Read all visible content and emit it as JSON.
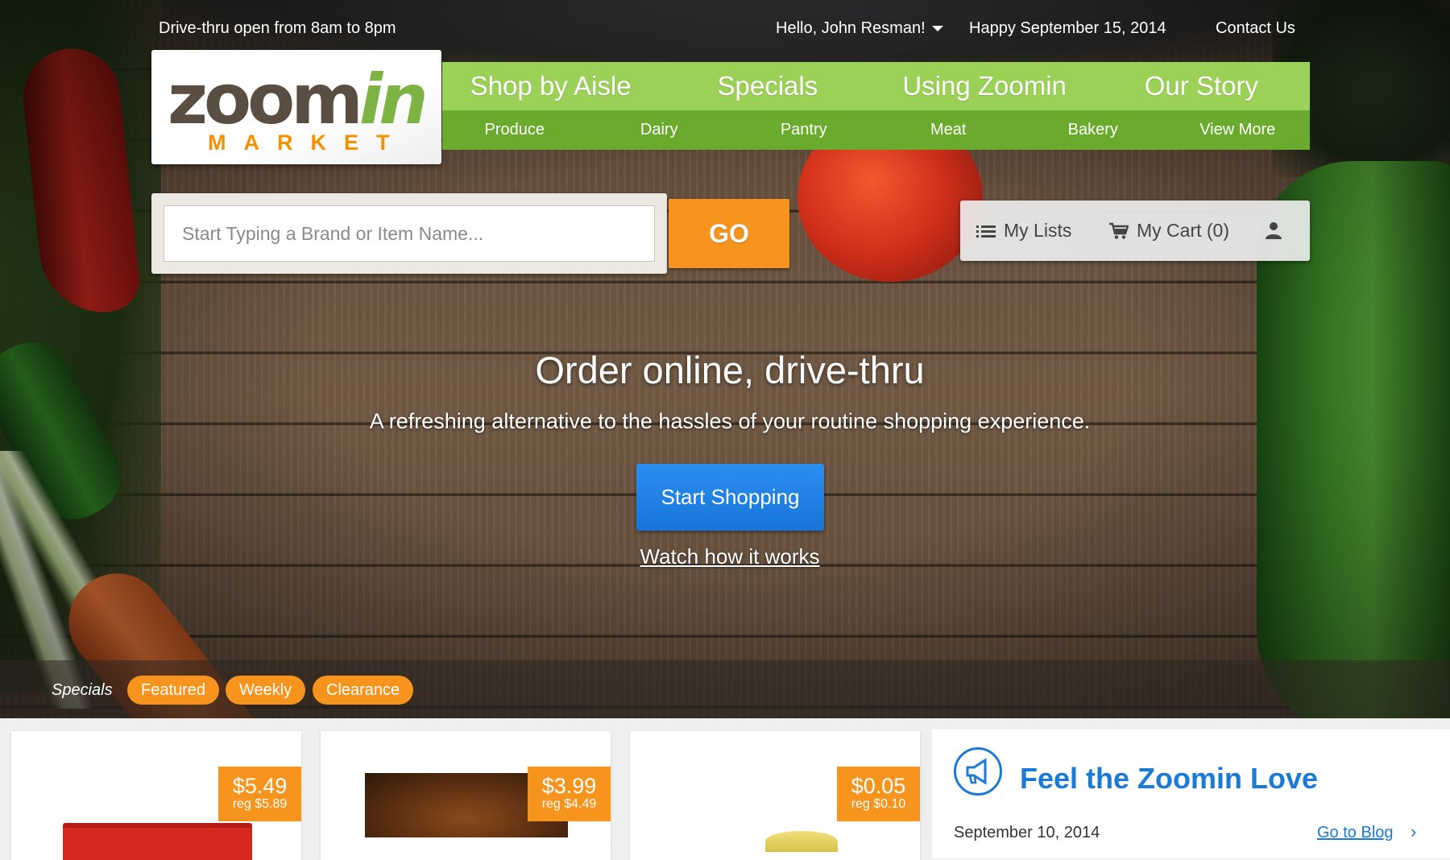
{
  "topbar": {
    "hours": "Drive-thru open from 8am to 8pm",
    "greeting": "Hello, John Resman!",
    "date": "Happy September 15, 2014",
    "contact": "Contact Us"
  },
  "logo": {
    "word_zoom": "zoom",
    "word_in": "in",
    "market": "MARKET"
  },
  "nav": {
    "main": [
      "Shop by Aisle",
      "Specials",
      "Using Zoomin",
      "Our Story"
    ],
    "sub": [
      "Produce",
      "Dairy",
      "Pantry",
      "Meat",
      "Bakery",
      "View More"
    ]
  },
  "search": {
    "placeholder": "Start Typing a Brand or Item Name...",
    "value": "",
    "button": "GO"
  },
  "account": {
    "lists": "My Lists",
    "cart": "My Cart (0)",
    "icons": [
      "list-icon",
      "cart-icon",
      "user-icon"
    ]
  },
  "hero": {
    "title": "Order online, drive-thru",
    "subtitle": "A refreshing alternative to the hassles of your routine shopping experience.",
    "cta": "Start Shopping",
    "watch": "Watch how it works"
  },
  "specials": {
    "label": "Specials",
    "tabs": [
      "Featured",
      "Weekly",
      "Clearance"
    ]
  },
  "products": [
    {
      "price": "$5.49",
      "reg": "reg $5.89"
    },
    {
      "price": "$3.99",
      "reg": "reg $4.49"
    },
    {
      "price": "$0.05",
      "reg": "reg $0.10"
    }
  ],
  "love": {
    "title": "Feel the Zoomin Love",
    "date": "September 10, 2014",
    "blog": "Go to Blog"
  },
  "colors": {
    "accent_orange": "#f7941d",
    "nav_green_light": "#9cd158",
    "nav_green_dark": "#6aaa2c",
    "cta_blue": "#1a7ad6"
  }
}
